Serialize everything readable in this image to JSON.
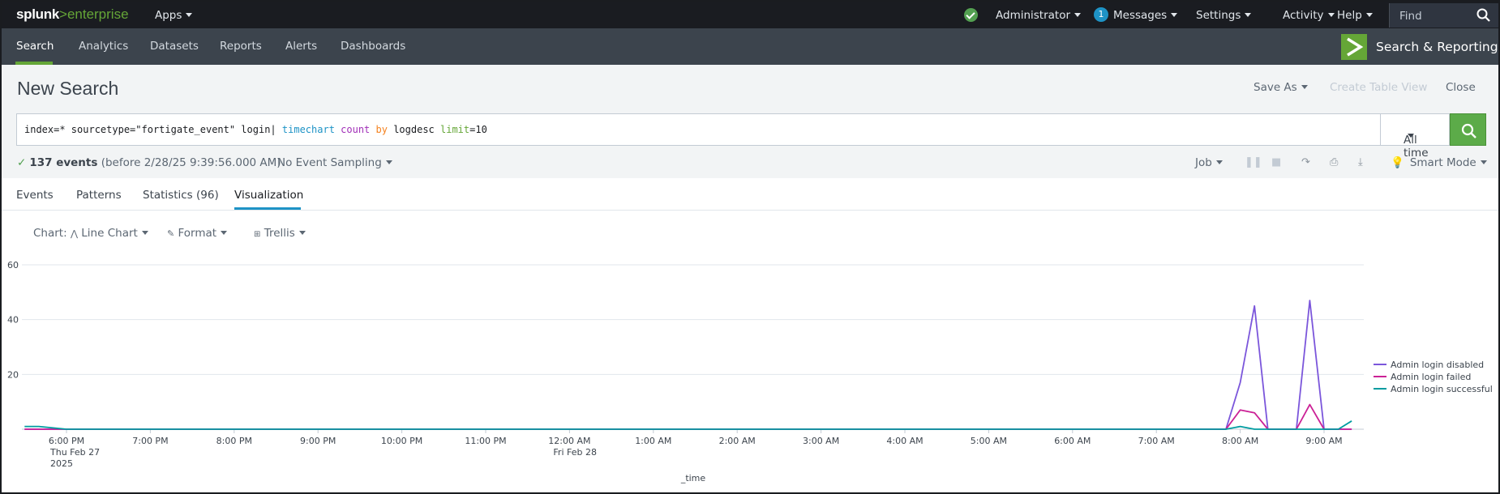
{
  "topbar": {
    "brand_main": "splunk",
    "brand_sep": ">",
    "brand_sub": "enterprise",
    "apps": "Apps",
    "user": "Administrator",
    "messages_count": "1",
    "messages": "Messages",
    "settings": "Settings",
    "activity": "Activity",
    "help": "Help",
    "find": "Find"
  },
  "appnav": {
    "items": [
      "Search",
      "Analytics",
      "Datasets",
      "Reports",
      "Alerts",
      "Dashboards"
    ],
    "app_name": "Search & Reporting",
    "accent": "#65a637"
  },
  "header": {
    "title": "New Search",
    "save_as": "Save As",
    "create_table": "Create Table View",
    "close": "Close"
  },
  "search": {
    "q1": "index=* sourcetype=\"fortigate_event\" login| ",
    "q_cmd": "timechart",
    "q_sp1": " ",
    "q_fn": "count",
    "q_sp2": " ",
    "q_kw": "by",
    "q_sp3": " logdesc ",
    "q_arg": "limit",
    "q_end": "=10",
    "time_range": "All time"
  },
  "status": {
    "events": "137 events",
    "before": " (before 2/28/25 9:39:56.000 AM)",
    "sampling": "No Event Sampling",
    "job": "Job",
    "mode": "Smart Mode"
  },
  "tabs": [
    "Events",
    "Patterns",
    "Statistics (96)",
    "Visualization"
  ],
  "viz": {
    "chart_label": "Chart:",
    "chart_type": "Line Chart",
    "format": "Format",
    "trellis": "Trellis"
  },
  "chart_data": {
    "type": "line",
    "xlabel": "_time",
    "ylim": [
      0,
      60
    ],
    "yticks": [
      20,
      40,
      60
    ],
    "x_tick_labels": [
      [
        "6:00 PM",
        "Thu Feb 27",
        "2025"
      ],
      [
        "7:00 PM"
      ],
      [
        "8:00 PM"
      ],
      [
        "9:00 PM"
      ],
      [
        "10:00 PM"
      ],
      [
        "11:00 PM"
      ],
      [
        "12:00 AM",
        "Fri Feb 28"
      ],
      [
        "1:00 AM"
      ],
      [
        "2:00 AM"
      ],
      [
        "3:00 AM"
      ],
      [
        "4:00 AM"
      ],
      [
        "5:00 AM"
      ],
      [
        "6:00 AM"
      ],
      [
        "7:00 AM"
      ],
      [
        "8:00 AM"
      ],
      [
        "9:00 AM"
      ]
    ],
    "x_hours": [
      -0.5,
      -0.33,
      0,
      1,
      2,
      3,
      4,
      5,
      6,
      7,
      8,
      9,
      10,
      11,
      12,
      13,
      13.83,
      14,
      14.17,
      14.33,
      14.5,
      14.67,
      14.83,
      15,
      15.17,
      15.33
    ],
    "legend_position": "right",
    "series": [
      {
        "name": "Admin login disabled",
        "color": "#7b56db",
        "values": [
          0,
          0,
          0,
          0,
          0,
          0,
          0,
          0,
          0,
          0,
          0,
          0,
          0,
          0,
          0,
          0,
          0,
          17,
          45,
          0,
          0,
          0,
          47,
          0,
          0,
          0
        ]
      },
      {
        "name": "Admin login failed",
        "color": "#cb2196",
        "values": [
          0,
          0,
          0,
          0,
          0,
          0,
          0,
          0,
          0,
          0,
          0,
          0,
          0,
          0,
          0,
          0,
          0,
          7,
          6,
          0,
          0,
          0,
          9,
          0,
          0,
          0
        ]
      },
      {
        "name": "Admin login successful",
        "color": "#009ca0",
        "values": [
          1,
          1,
          0,
          0,
          0,
          0,
          0,
          0,
          0,
          0,
          0,
          0,
          0,
          0,
          0,
          0,
          0,
          1,
          0,
          0,
          0,
          0,
          0,
          0,
          0,
          3
        ]
      }
    ]
  }
}
